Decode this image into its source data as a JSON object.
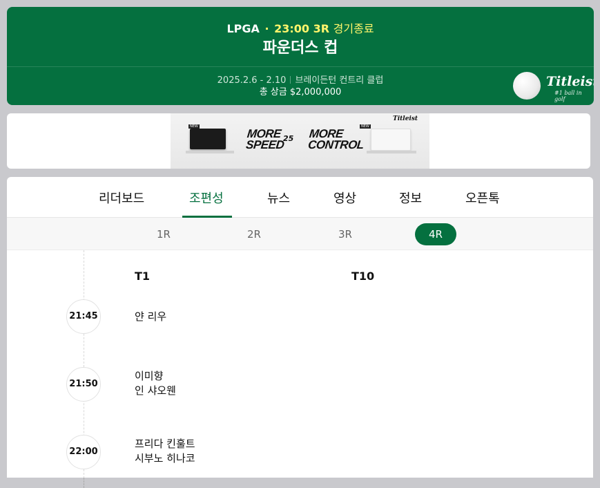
{
  "header": {
    "tour": "LPGA",
    "separator": "·",
    "time_round": "23:00 3R",
    "status": "경기종료",
    "title": "파운더스 컵",
    "dates": "2025.2.6 - 2.10",
    "venue": "브레이든턴 컨트리 클럽",
    "prize": "총 상금 $2,000,000",
    "sponsor_brand": "Titleist",
    "sponsor_tagline": "#1 ball in golf"
  },
  "ad": {
    "left_text": "MORE SPEED",
    "middle_text": "25",
    "right_text": "MORE CONTROL",
    "logo": "Titleist",
    "badge": "NEW"
  },
  "tabs": [
    {
      "label": "리더보드"
    },
    {
      "label": "조편성"
    },
    {
      "label": "뉴스"
    },
    {
      "label": "영상"
    },
    {
      "label": "정보"
    },
    {
      "label": "오픈톡"
    }
  ],
  "active_tab": "조편성",
  "rounds": [
    {
      "label": "1R"
    },
    {
      "label": "2R"
    },
    {
      "label": "3R"
    },
    {
      "label": "4R"
    }
  ],
  "active_round": "4R",
  "columns": {
    "left": "T1",
    "right": "T10"
  },
  "groups": [
    {
      "time": "21:45",
      "players": [
        "얀 리우"
      ]
    },
    {
      "time": "21:50",
      "players": [
        "이미향",
        "인 샤오웬"
      ]
    },
    {
      "time": "22:00",
      "players": [
        "프리다 킨훌트",
        "시부노 히나코"
      ]
    }
  ],
  "colors": {
    "brand_green": "#05703f",
    "highlight_yellow": "#fff56b"
  }
}
